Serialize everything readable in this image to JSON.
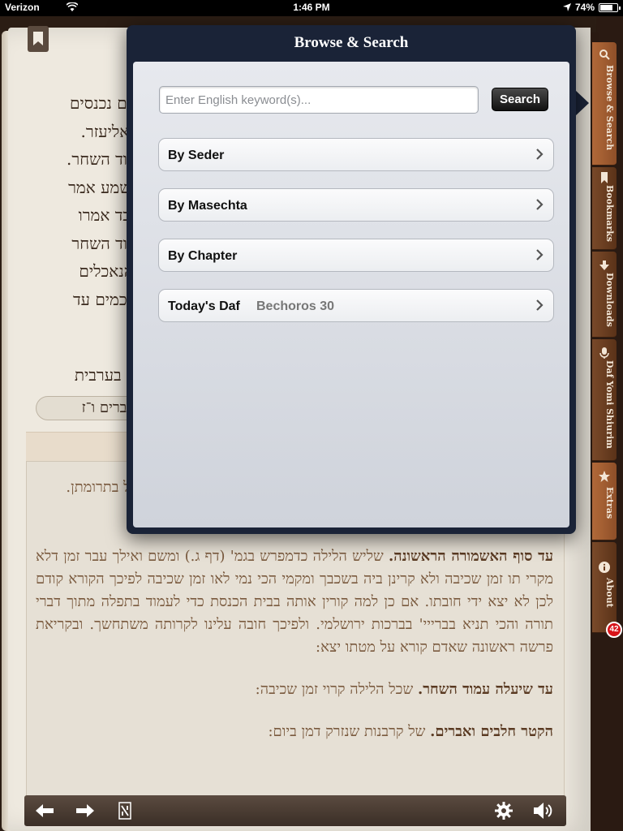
{
  "status_bar": {
    "carrier": "Verizon",
    "time": "1:46 PM",
    "battery": "74%",
    "battery_level": 0.74
  },
  "reader": {
    "hebrew_lines": [
      "הנים נכנסים",
      "ר׳ אליעזר.",
      "עמוד השחר.",
      "ת שמע אמר",
      "בלבד אמרו",
      "עמוד השחר",
      "ל הנאכלים",
      "ו חכמים עד"
    ],
    "hebrew_line5": "תני בערבית",
    "reference": "דברים ו־ז",
    "commentary_short": "כול בתרומתן.",
    "commentary": [
      {
        "bold": "עד סוף האשמורה הראשונה.",
        "text": " שליש הלילה כדמפרש בגמ' (דף ג.) ומשם ואילך עבר זמן דלא מקרי תו זמן שכיבה ולא קרינן ביה בשכבך ומקמי הכי נמי לאו זמן שכיבה לפיכך הקורא קודם לכן לא יצא ידי חובתו. אם כן למה קורין אותה בבית הכנסת כדי לעמוד בתפלה מתוך דברי תורה והכי תניא בברייי' בברכות ירושלמי. ולפיכך חובה עלינו לקרותה משתחשך. ובקריאת פרשה ראשונה שאדם קורא על מטתו יצא:"
      },
      {
        "bold": "עד שיעלה עמוד השחר.",
        "text": " שכל הלילה קרוי זמן שכיבה:"
      },
      {
        "bold": "הקטר חלבים ואברים.",
        "text": " של קרבנות שנזרק דמן ביום:"
      }
    ]
  },
  "popover": {
    "title": "Browse & Search",
    "search_placeholder": "Enter English keyword(s)...",
    "search_value": "",
    "search_button": "Search",
    "rows": [
      {
        "label": "By Seder",
        "detail": ""
      },
      {
        "label": "By Masechta",
        "detail": ""
      },
      {
        "label": "By Chapter",
        "detail": ""
      },
      {
        "label": "Today's Daf",
        "detail": "Bechoros 30"
      }
    ]
  },
  "side_tabs": [
    {
      "label": "Browse & Search",
      "icon": "search-icon",
      "active": true
    },
    {
      "label": "Bookmarks",
      "icon": "bookmark-icon",
      "active": false
    },
    {
      "label": "Downloads",
      "icon": "download-icon",
      "active": false
    },
    {
      "label": "Daf Yomi Shiurim",
      "icon": "microphone-icon",
      "active": false
    },
    {
      "label": "Extras",
      "icon": "star-icon",
      "active": true
    },
    {
      "label": "About",
      "icon": "info-icon",
      "active": false
    }
  ],
  "badge_count": "42",
  "toolbar": {
    "icons": [
      "back-arrow-icon",
      "forward-arrow-icon",
      "hebrew-letter-icon",
      "gear-icon",
      "speaker-icon"
    ]
  }
}
